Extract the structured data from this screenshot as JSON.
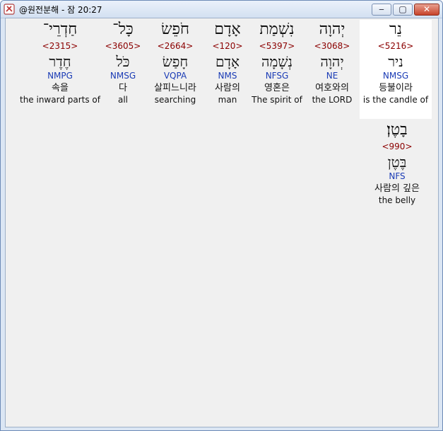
{
  "window": {
    "title": "@원전분해 - 잠 20:27",
    "controls": {
      "minimize": "‒",
      "maximize": "▢",
      "close": "✕"
    }
  },
  "words": [
    {
      "hebrew": "נֵר",
      "strong": "<5216>",
      "root": "ניר",
      "morph": "NMSG",
      "korean": "등불이라",
      "english": "is the candle of"
    },
    {
      "hebrew": "יְהוָה",
      "strong": "<3068>",
      "root": "יְהוָה",
      "morph": "NE",
      "korean": "여호와의",
      "english": "the LORD"
    },
    {
      "hebrew": "נִשְׁמַת",
      "strong": "<5397>",
      "root": "נְשָׁמָה",
      "morph": "NFSG",
      "korean": "영혼은",
      "english": "The spirit of"
    },
    {
      "hebrew": "אָדָם",
      "strong": "<120>",
      "root": "אָדָם",
      "morph": "NMS",
      "korean": "사람의",
      "english": "man"
    },
    {
      "hebrew": "חֹפֵשׂ",
      "strong": "<2664>",
      "root": "חָפַשׂ",
      "morph": "VQPA",
      "korean": "살피느니라",
      "english": "searching"
    },
    {
      "hebrew": "כָּל־",
      "strong": "<3605>",
      "root": "כֹּל",
      "morph": "NMSG",
      "korean": "다",
      "english": "all"
    },
    {
      "hebrew": "חַדְרֵי־",
      "strong": "<2315>",
      "root": "חֶדֶר",
      "morph": "NMPG",
      "korean": "속을",
      "english": "the inward parts of"
    },
    {
      "hebrew": "בָטֶן׃",
      "strong": "<990>",
      "root": "בֶּטֶן",
      "morph": "NFS",
      "korean": "사람의 깊은",
      "english": "the belly"
    }
  ]
}
